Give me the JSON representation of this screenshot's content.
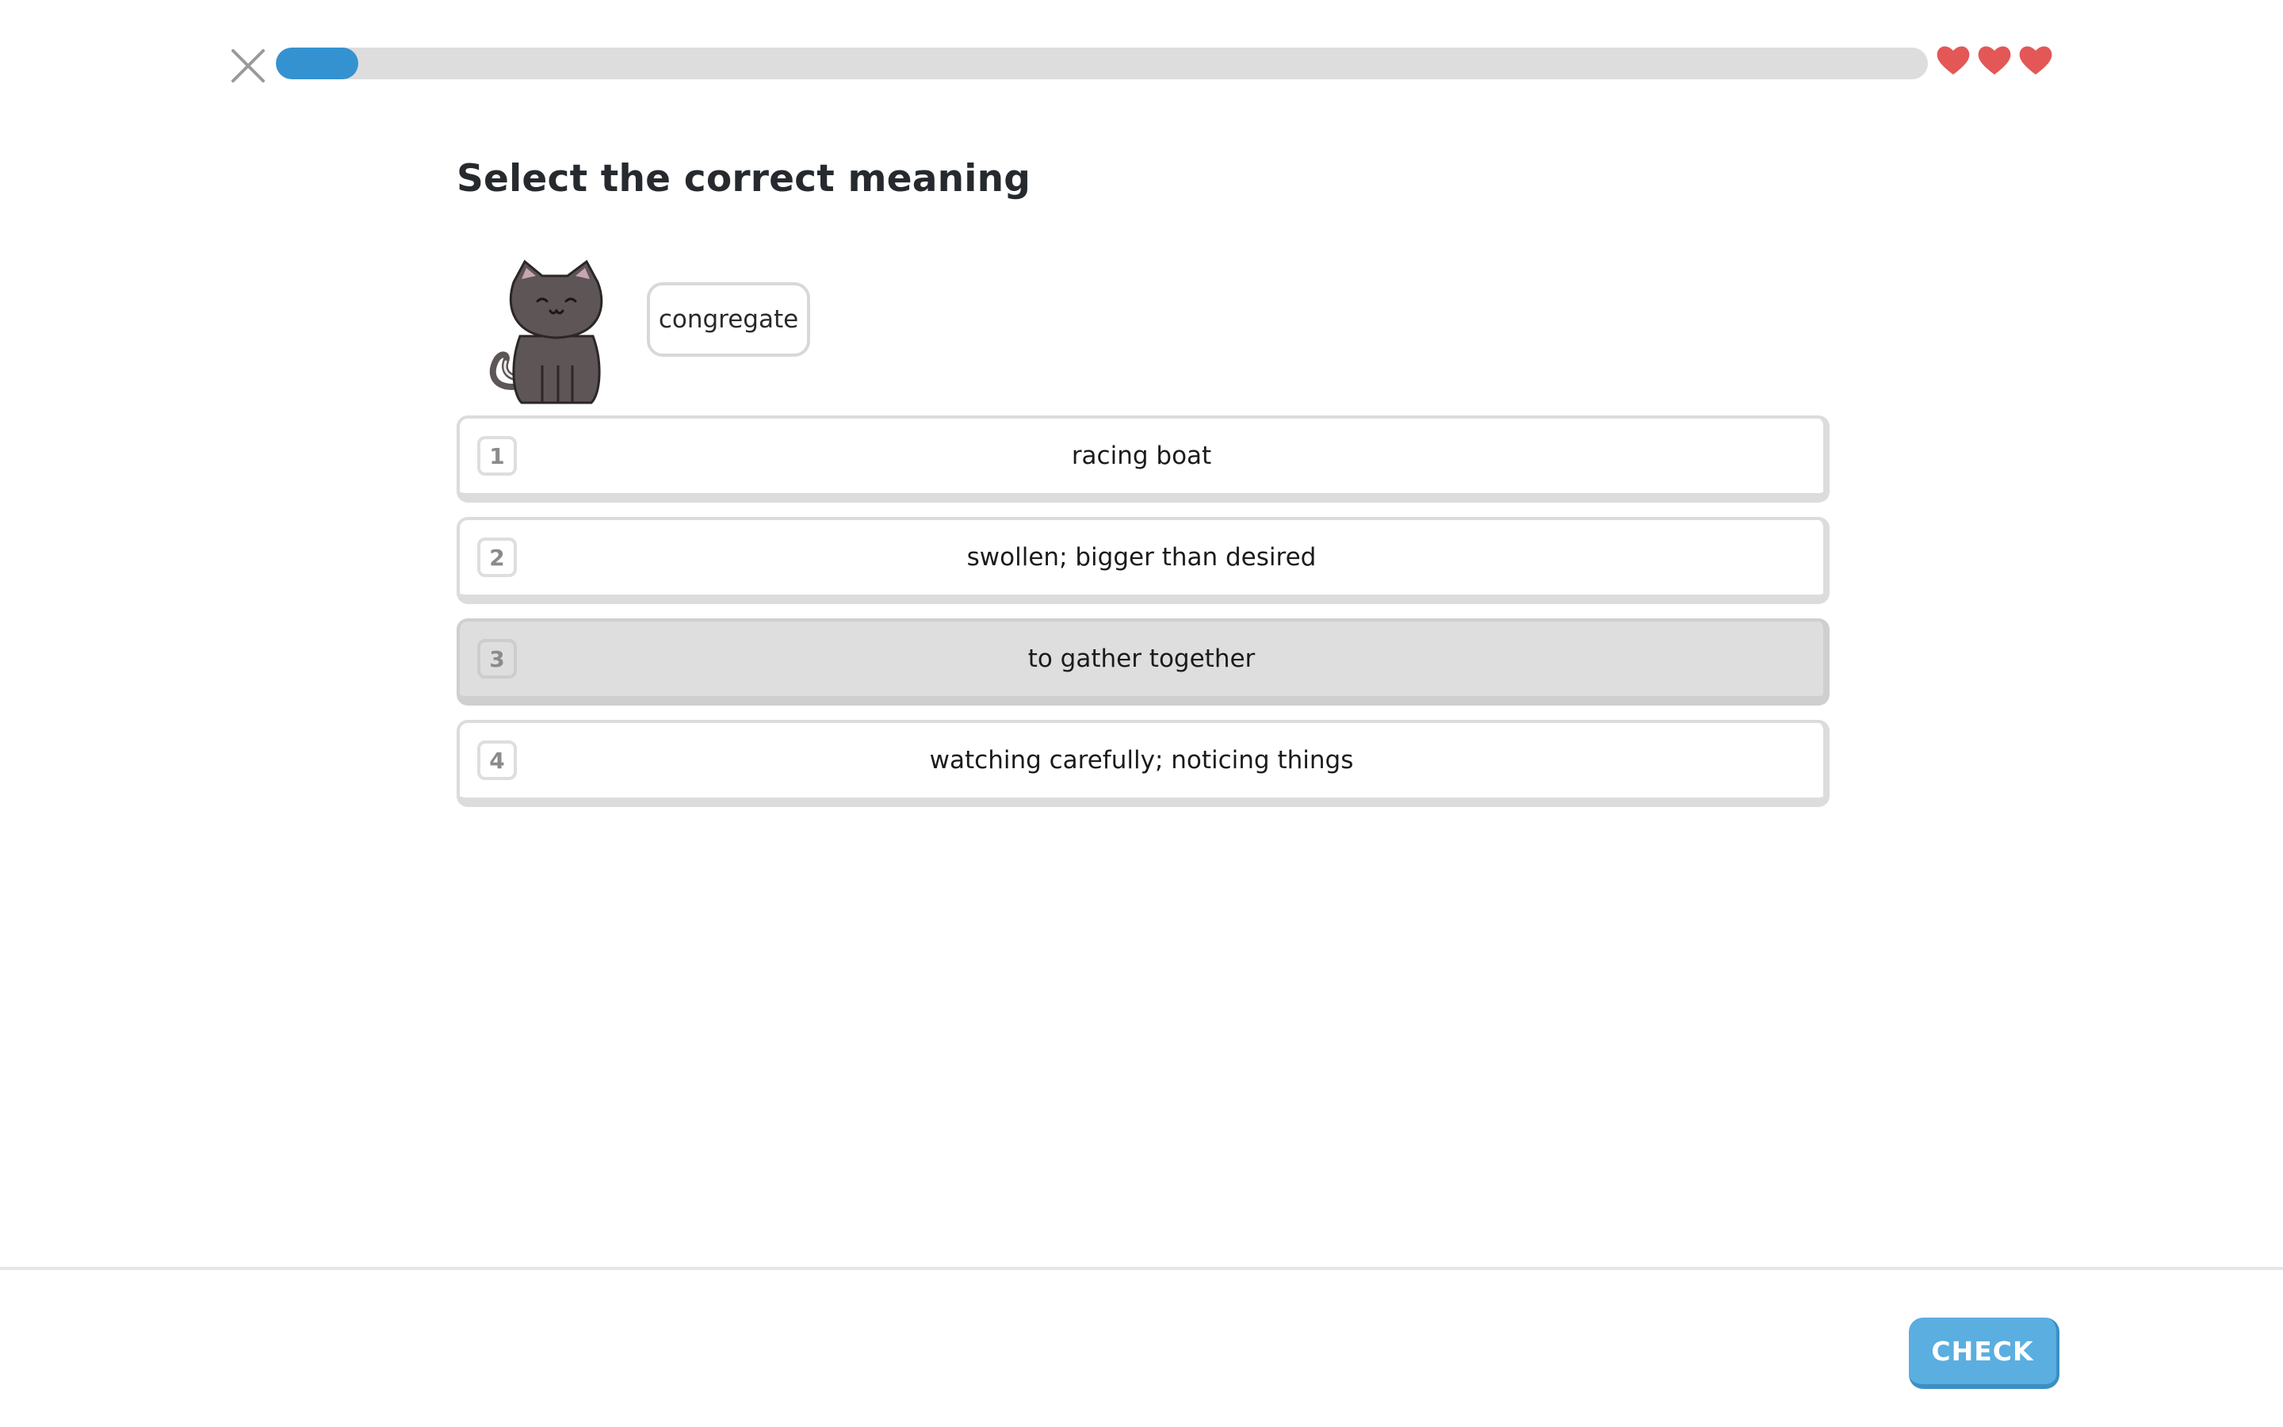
{
  "header": {
    "progress": 0.05,
    "progress_color": "#3592d0",
    "track_color": "#dddddd",
    "lives": 3,
    "heart_color": "#e35757",
    "close_icon": "close-icon",
    "heart_icon": "heart-icon"
  },
  "prompt": {
    "title": "Select the correct meaning",
    "word": "congregate",
    "mascot_icon": "cat-mascot-icon"
  },
  "options": [
    {
      "number": "1",
      "label": "racing boat",
      "selected": false
    },
    {
      "number": "2",
      "label": "swollen; bigger than desired",
      "selected": false
    },
    {
      "number": "3",
      "label": "to gather together",
      "selected": true
    },
    {
      "number": "4",
      "label": "watching carefully; noticing things",
      "selected": false
    }
  ],
  "footer": {
    "check_label": "CHECK",
    "check_color": "#5aaee0"
  }
}
